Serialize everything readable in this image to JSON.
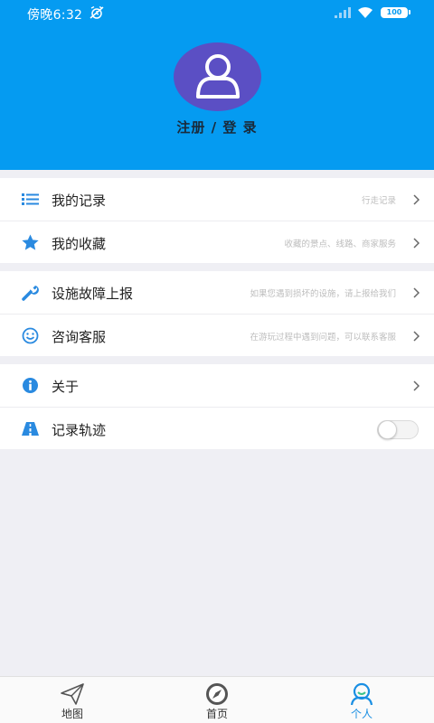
{
  "status_bar": {
    "time": "傍晚6:32",
    "battery": "100"
  },
  "profile": {
    "login_label": "注册 / 登 录"
  },
  "groups": [
    {
      "items": [
        {
          "label": "我的记录",
          "hint": "行走记录",
          "icon": "list-icon"
        },
        {
          "label": "我的收藏",
          "hint": "收藏的景点、线路、商家服务",
          "icon": "star-icon"
        }
      ]
    },
    {
      "items": [
        {
          "label": "设施故障上报",
          "hint": "如果您遇到损坏的设施，请上报给我们",
          "icon": "wrench-icon"
        },
        {
          "label": "咨询客服",
          "hint": "在游玩过程中遇到问题，可以联系客服",
          "icon": "smiley-icon"
        }
      ]
    },
    {
      "items": [
        {
          "label": "关于",
          "hint": "",
          "icon": "info-icon"
        },
        {
          "label": "记录轨迹",
          "hint": "",
          "icon": "road-icon",
          "toggle": false
        }
      ]
    }
  ],
  "tabs": [
    {
      "label": "地图",
      "icon": "paper-plane-icon",
      "active": false
    },
    {
      "label": "首页",
      "icon": "compass-icon",
      "active": false
    },
    {
      "label": "个人",
      "icon": "person-icon",
      "active": true
    }
  ],
  "colors": {
    "header": "#059bf1",
    "avatar": "#5b4fc4",
    "icon_blue": "#2a8ae0",
    "active_tab": "#1a8fe3"
  }
}
